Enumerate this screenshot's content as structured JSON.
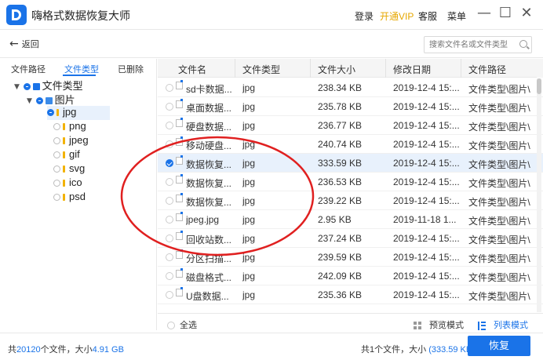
{
  "app": {
    "title": "嗨格式数据恢复大师",
    "login": "登录",
    "vip": "开通VIP",
    "service": "客服",
    "menu": "菜单",
    "minimize": "—",
    "maximize": "☐",
    "close": "✕",
    "logo_icon": "app-logo-icon"
  },
  "toolbar": {
    "back_arrow": "←",
    "back_label": "返回",
    "search_placeholder": "搜索文件名或文件类型"
  },
  "left_tabs": [
    "文件路径",
    "文件类型",
    "已删除"
  ],
  "left_tab_active": 1,
  "tree": {
    "root": "文件类型",
    "picture": "图片",
    "items": [
      "jpg",
      "png",
      "jpeg",
      "gif",
      "svg",
      "ico",
      "psd"
    ],
    "selected_index": 0
  },
  "table": {
    "headers": [
      "文件名",
      "文件类型",
      "文件大小",
      "修改日期",
      "文件路径"
    ],
    "rows": [
      {
        "name": "sd卡数据...",
        "type": "jpg",
        "size": "238.34 KB",
        "date": "2019-12-4 15:...",
        "path": "文件类型\\图片\\",
        "checked": false
      },
      {
        "name": "桌面数据...",
        "type": "jpg",
        "size": "235.78 KB",
        "date": "2019-12-4 15:...",
        "path": "文件类型\\图片\\",
        "checked": false
      },
      {
        "name": "硬盘数据...",
        "type": "jpg",
        "size": "236.77 KB",
        "date": "2019-12-4 15:...",
        "path": "文件类型\\图片\\",
        "checked": false
      },
      {
        "name": "移动硬盘...",
        "type": "jpg",
        "size": "240.74 KB",
        "date": "2019-12-4 15:...",
        "path": "文件类型\\图片\\",
        "checked": false
      },
      {
        "name": "数据恢复...",
        "type": "jpg",
        "size": "333.59 KB",
        "date": "2019-12-4 15:...",
        "path": "文件类型\\图片\\",
        "checked": true
      },
      {
        "name": "数据恢复...",
        "type": "jpg",
        "size": "236.53 KB",
        "date": "2019-12-4 15:...",
        "path": "文件类型\\图片\\",
        "checked": false
      },
      {
        "name": "数据恢复...",
        "type": "jpg",
        "size": "239.22 KB",
        "date": "2019-12-4 15:...",
        "path": "文件类型\\图片\\",
        "checked": false
      },
      {
        "name": "jpeg.jpg",
        "type": "jpg",
        "size": "2.95 KB",
        "date": "2019-11-18 1...",
        "path": "文件类型\\图片\\",
        "checked": false
      },
      {
        "name": "回收站数...",
        "type": "jpg",
        "size": "237.24 KB",
        "date": "2019-12-4 15:...",
        "path": "文件类型\\图片\\",
        "checked": false
      },
      {
        "name": "分区扫描...",
        "type": "jpg",
        "size": "239.59 KB",
        "date": "2019-12-4 15:...",
        "path": "文件类型\\图片\\",
        "checked": false
      },
      {
        "name": "磁盘格式...",
        "type": "jpg",
        "size": "242.09 KB",
        "date": "2019-12-4 15:...",
        "path": "文件类型\\图片\\",
        "checked": false
      },
      {
        "name": "U盘数据...",
        "type": "jpg",
        "size": "235.36 KB",
        "date": "2019-12-4 15:...",
        "path": "文件类型\\图片\\",
        "checked": false
      }
    ]
  },
  "footer": {
    "select_all": "全选",
    "preview_mode": "预览模式",
    "list_mode": "列表模式"
  },
  "status": {
    "total_prefix": "共",
    "total_count": "20120",
    "total_mid": "个文件，大小",
    "total_size": "4.91 GB",
    "selected_prefix": "共1个文件，大小",
    "selected_size": "(333.59 KB)",
    "recover_label": "恢复"
  },
  "colors": {
    "accent": "#1a73e8",
    "vip": "#e6a700",
    "annotation": "#e02020"
  }
}
